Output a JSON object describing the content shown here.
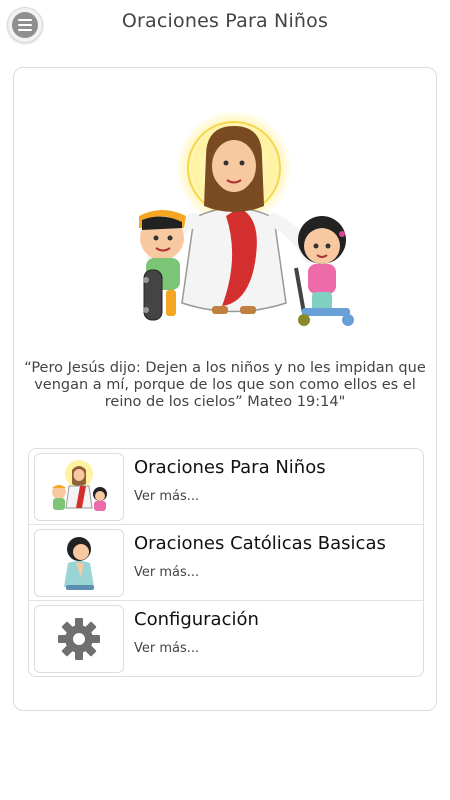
{
  "header": {
    "title": "Oraciones Para Niños",
    "menu_icon": "menu-icon"
  },
  "main": {
    "quote": "“Pero Jesús dijo: Dejen a los niños y no les impidan que vengan a mí, porque de los que son como ellos es el reino de los cielos” Mateo 19:14\"",
    "items": [
      {
        "title": "Oraciones Para Niños",
        "subtitle": "Ver más...",
        "icon": "jesus-children-icon"
      },
      {
        "title": "Oraciones Católicas Basicas",
        "subtitle": "Ver más...",
        "icon": "praying-child-icon"
      },
      {
        "title": "Configuración",
        "subtitle": "Ver más...",
        "icon": "gear-icon"
      }
    ]
  },
  "colors": {
    "robe_sash": "#d32f2f",
    "halo": "#fff3a0",
    "text": "#333333",
    "border": "#dcdcdc"
  }
}
